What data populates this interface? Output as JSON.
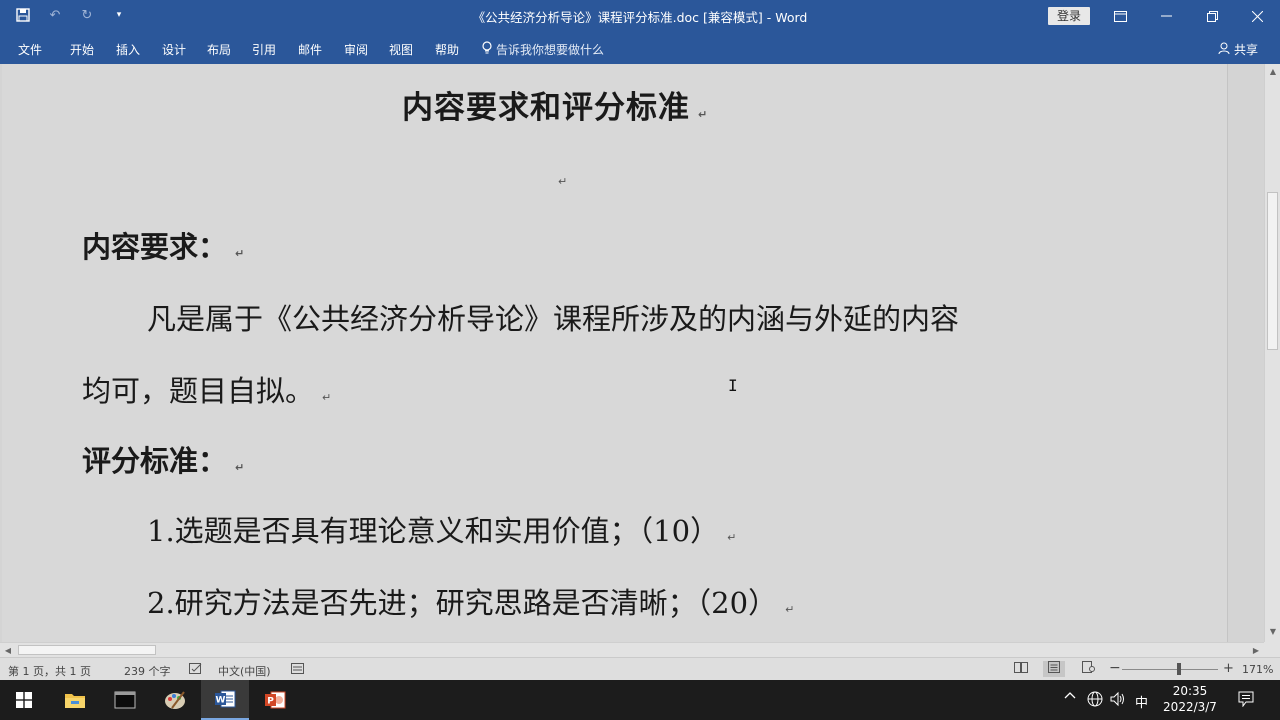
{
  "window": {
    "title": "《公共经济分析导论》课程评分标准.doc [兼容模式] - Word",
    "login_label": "登录"
  },
  "ribbon": {
    "tabs": [
      "文件",
      "开始",
      "插入",
      "设计",
      "布局",
      "引用",
      "邮件",
      "审阅",
      "视图",
      "帮助"
    ],
    "tell_me": "告诉我你想要做什么",
    "share": "共享"
  },
  "document": {
    "title": "内容要求和评分标准",
    "section_requirements": "内容要求：",
    "para1_line1": "凡是属于《公共经济分析导论》课程所涉及的内涵与外延的内容",
    "para1_line2": "均可，题目自拟。",
    "section_criteria": "评分标准：",
    "item1": "1.选题是否具有理论意义和实用价值；（10）",
    "item2": "2.研究方法是否先进；研究思路是否清晰；（20）",
    "paragraph_mark": "↵",
    "cursor": "I"
  },
  "statusbar": {
    "page_info": "第 1 页，共 1 页",
    "word_count": "239 个字",
    "language": "中文(中国)",
    "zoom": "171%",
    "zoom_minus": "−",
    "zoom_plus": "+"
  },
  "taskbar": {
    "ime": "中",
    "time": "20:35",
    "date": "2022/3/7"
  },
  "colors": {
    "ribbon": "#2b579a",
    "taskbar": "#1c1c1c",
    "word_icon": "#2b579a",
    "ppt_icon": "#d24726"
  }
}
